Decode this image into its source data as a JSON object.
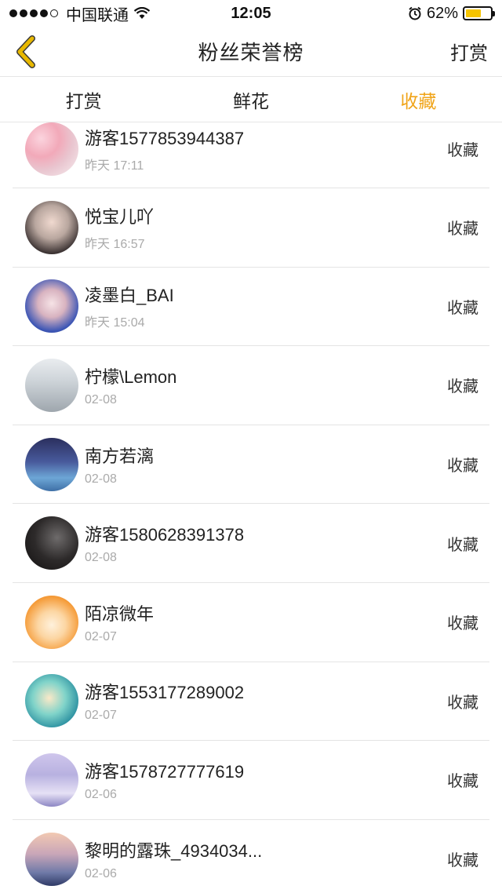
{
  "status_bar": {
    "carrier": "中国联通",
    "time": "12:05",
    "battery": "62%",
    "battery_level": 0.62
  },
  "nav": {
    "title": "粉丝荣誉榜",
    "right_label": "打赏"
  },
  "tabs": [
    {
      "label": "打赏",
      "active": false
    },
    {
      "label": "鲜花",
      "active": false
    },
    {
      "label": "收藏",
      "active": true
    }
  ],
  "colors": {
    "accent": "#f0a419",
    "back_icon": "#e8b800"
  },
  "list": [
    {
      "name": "游客1577853944387",
      "time": "昨天 17:11",
      "action": "收藏",
      "avatar": "cherry-blossom-avatar"
    },
    {
      "name": "悦宝儿吖",
      "time": "昨天 16:57",
      "action": "收藏",
      "avatar": "girl-portrait-avatar"
    },
    {
      "name": "凌墨白_BAI",
      "time": "昨天 15:04",
      "action": "收藏",
      "avatar": "anime-girl-avatar"
    },
    {
      "name": "柠檬\\Lemon",
      "time": "02-08",
      "action": "收藏",
      "avatar": "snow-street-avatar"
    },
    {
      "name": "南方若漓",
      "time": "02-08",
      "action": "收藏",
      "avatar": "tree-lake-avatar"
    },
    {
      "name": "游客1580628391378",
      "time": "02-08",
      "action": "收藏",
      "avatar": "dark-girl-avatar"
    },
    {
      "name": "陌凉微年",
      "time": "02-07",
      "action": "收藏",
      "avatar": "orange-hood-avatar"
    },
    {
      "name": "游客1553177289002",
      "time": "02-07",
      "action": "收藏",
      "avatar": "teal-hair-avatar"
    },
    {
      "name": "游客1578727777619",
      "time": "02-06",
      "action": "收藏",
      "avatar": "plaid-skirt-avatar"
    },
    {
      "name": "黎明的露珠_4934034...",
      "time": "02-06",
      "action": "收藏",
      "avatar": "sunset-silhouette-avatar"
    }
  ]
}
